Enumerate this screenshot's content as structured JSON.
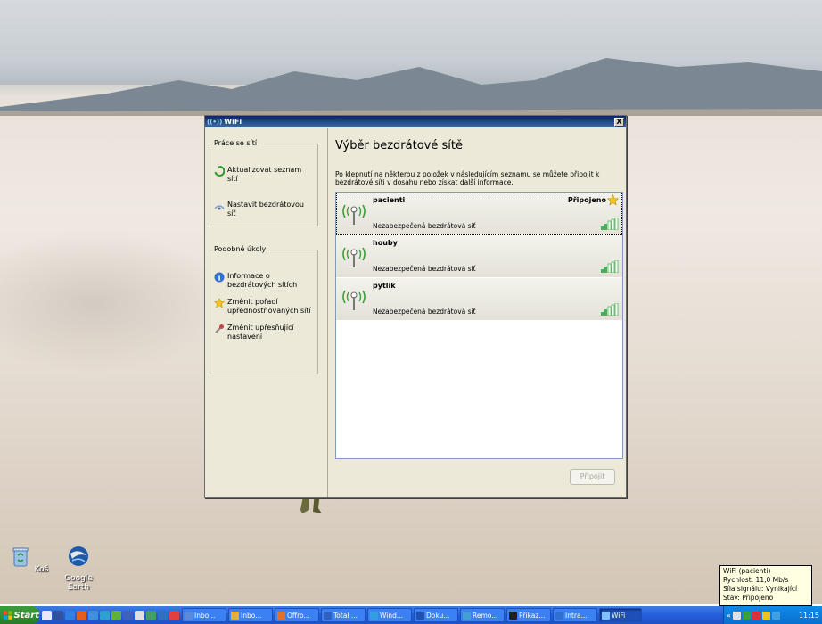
{
  "window": {
    "title": "WiFi",
    "close_glyph": "X",
    "heading": "Výběr bezdrátové sítě",
    "intro": "Po klepnutí na některou z položek v následujícím seznamu se můžete připojit k bezdrátové síti v dosahu nebo získat další informace.",
    "connect_button": "Připojit"
  },
  "left_pane": {
    "network_tasks": {
      "title": "Práce se sítí",
      "items": [
        {
          "label": "Aktualizovat seznam sítí",
          "icon": "refresh-icon"
        },
        {
          "label": "Nastavit bezdrátovou síť",
          "icon": "wireless-setup-icon"
        }
      ]
    },
    "related_tasks": {
      "title": "Podobné úkoly",
      "items": [
        {
          "label": "Informace o bezdrátových sítích",
          "icon": "info-icon"
        },
        {
          "label": "Změnit pořadí upřednostňovaných sítí",
          "icon": "star-icon"
        },
        {
          "label": "Změnit upřesňující nastavení",
          "icon": "settings-icon"
        }
      ]
    }
  },
  "networks": [
    {
      "ssid": "pacienti",
      "security": "Nezabezpečená bezdrátová síť",
      "status": "Připojeno",
      "signal_bars": 5,
      "selected": true
    },
    {
      "ssid": "houby",
      "security": "Nezabezpečená bezdrátová síť",
      "status": "",
      "signal_bars": 5,
      "selected": false
    },
    {
      "ssid": "pytlik",
      "security": "Nezabezpečená bezdrátová síť",
      "status": "",
      "signal_bars": 5,
      "selected": false
    }
  ],
  "desktop_icons": [
    {
      "label": "Koš",
      "icon": "recycle-bin-icon"
    },
    {
      "label": "Google Earth",
      "icon": "google-earth-icon"
    }
  ],
  "tooltip": {
    "line1": "WiFi (pacienti)",
    "line2": "Rychlost: 11,0 Mb/s",
    "line3": "Síla signálu: Vynikající",
    "line4": "Stav: Připojeno"
  },
  "taskbar": {
    "start_label": "Start",
    "tasks": [
      {
        "label": "Inbo...",
        "color": "#5a8ad8"
      },
      {
        "label": "Inbo...",
        "color": "#e8b030"
      },
      {
        "label": "Offro...",
        "color": "#e07030"
      },
      {
        "label": "Total ...",
        "color": "#3060c0"
      },
      {
        "label": "Wind...",
        "color": "#30a0e0"
      },
      {
        "label": "Doku...",
        "color": "#2050b0"
      },
      {
        "label": "Remo...",
        "color": "#40a0d0"
      },
      {
        "label": "Příkaz...",
        "color": "#202020"
      },
      {
        "label": "Intra...",
        "color": "#3070d0"
      },
      {
        "label": "WiFi",
        "color": "#80c0ff",
        "active": true
      }
    ],
    "clock": "11:15",
    "tray_chevron": "«"
  },
  "colors": {
    "titlebar": "#0a246a",
    "taskbar": "#245edb",
    "start": "#2f8f2f",
    "signal_green": "#4caf50"
  }
}
